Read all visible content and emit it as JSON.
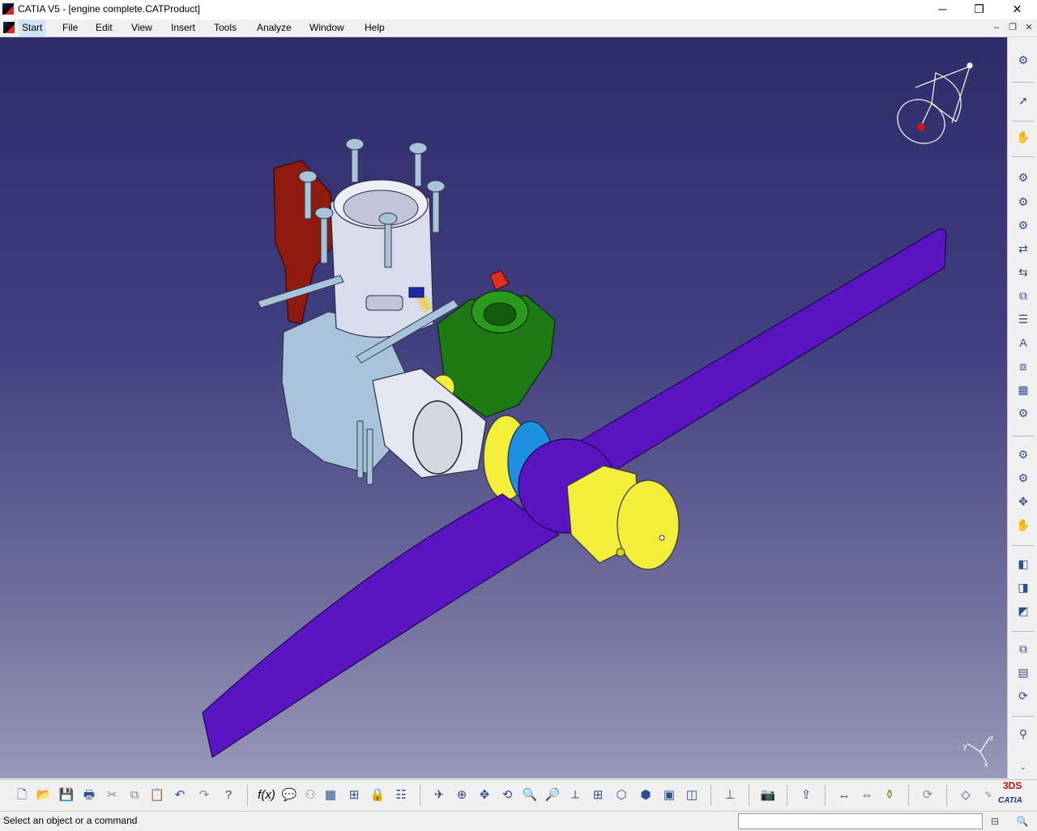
{
  "window": {
    "title": "CATIA V5 - [engine complete.CATProduct]",
    "minimize": "─",
    "restore": "❐",
    "close": "✕"
  },
  "menu": {
    "items": [
      "Start",
      "File",
      "Edit",
      "View",
      "Insert",
      "Tools",
      "Analyze",
      "Window",
      "Help"
    ],
    "doc_minimize": "–",
    "doc_restore": "❐",
    "doc_close": "✕"
  },
  "viewport": {
    "background_top": "#2f2c6a",
    "background_bottom": "#9998b8",
    "propeller_color": "#5a14c2",
    "spinner_color": "#f2ee3a",
    "carburetor_color": "#1e7a12",
    "crankcase_color": "#a9c4da",
    "mount_color": "#8e1a10",
    "washer_color": "#1f8fe0",
    "axis_labels": {
      "x": "x",
      "y": "y",
      "z": "z"
    }
  },
  "right_toolbar": {
    "icons": [
      "settings-gear-icon",
      "select-arrow-icon",
      "hand-gear-icon",
      "new-component-icon",
      "new-part-icon",
      "existing-component-icon",
      "replace-component-icon",
      "graph-tree-icon",
      "multi-instantiation-icon",
      "reorder-icon",
      "text-annotation-icon",
      "fast-multi-instance-icon",
      "scene-icon",
      "assembly-features-icon",
      "manipulation-icon",
      "snap-icon",
      "explode-icon",
      "stop-manip-icon",
      "constraint-coincidence-icon",
      "constraint-contact-icon",
      "constraint-offset-icon",
      "reuse-pattern-icon",
      "catalog-icon",
      "update-icon",
      "measure-icon"
    ]
  },
  "bottom_toolbar": {
    "icons": [
      "new-icon",
      "open-icon",
      "save-icon",
      "print-icon",
      "cut-icon",
      "copy-icon",
      "paste-icon",
      "undo-icon",
      "redo-icon",
      "whats-this-icon",
      "formula-icon",
      "comment-icon",
      "knowledge-icon",
      "table-icon",
      "design-table-icon",
      "lock-icon",
      "parameter-list-icon",
      "fly-mode-icon",
      "fit-all-icon",
      "pan-icon",
      "rotate-icon",
      "zoom-in-icon",
      "zoom-out-icon",
      "normal-view-icon",
      "multi-view-icon",
      "iso-view-icon",
      "shading-icon",
      "hide-show-icon",
      "swap-visible-icon",
      "analysis-icon",
      "capture-icon",
      "publish-icon",
      "measure-between-icon",
      "measure-item-icon",
      "measure-inertia-icon",
      "update-all-icon",
      "apply-material-icon",
      "sketch-icon"
    ],
    "logo_ds": "3DS",
    "logo_text": "CATIA"
  },
  "status": {
    "message": "Select an object or a command",
    "command_placeholder": ""
  }
}
